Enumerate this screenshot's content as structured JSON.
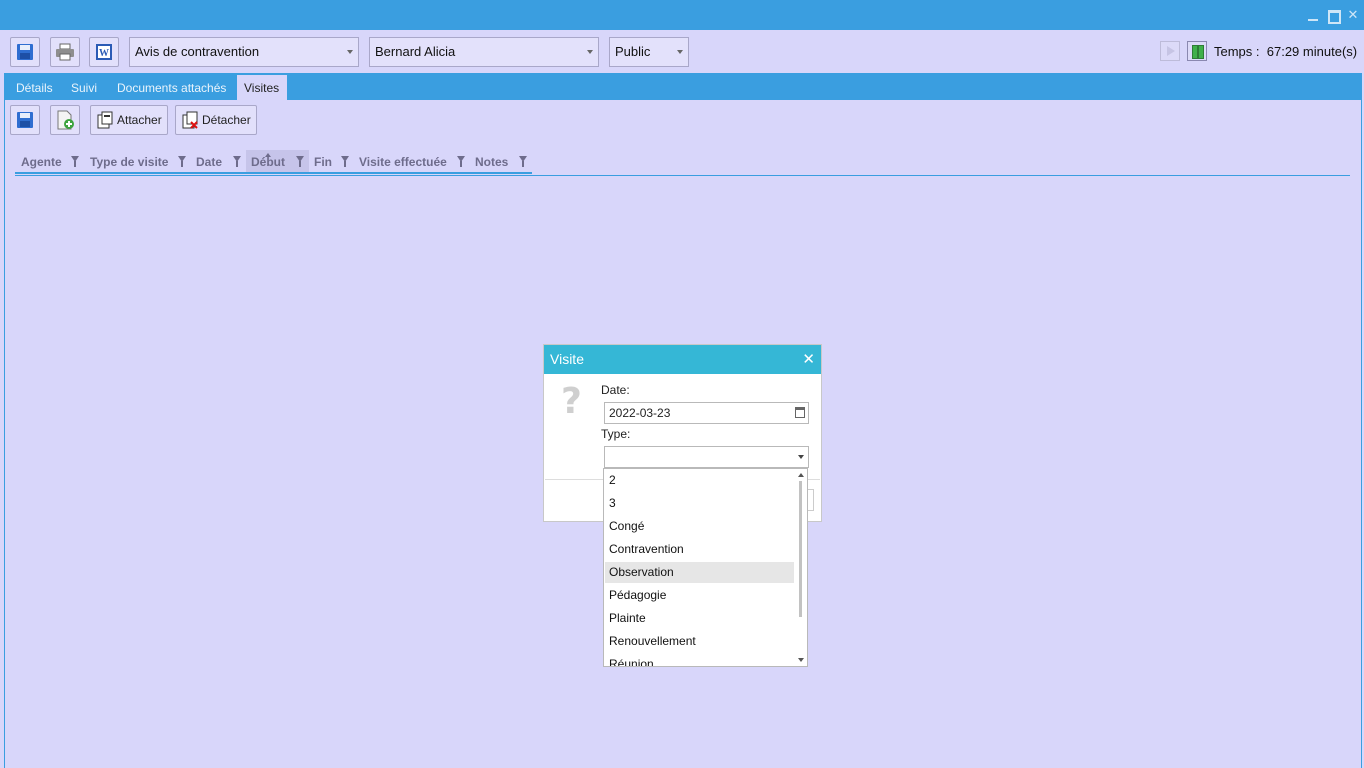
{
  "window": {
    "min_icon": "minimize-icon",
    "max_icon": "maximize-icon",
    "close_label": "✕"
  },
  "toolbar": {
    "document_type": "Avis de contravention",
    "person": "Bernard Alicia",
    "visibility": "Public",
    "timer_label": "Temps :",
    "timer_value": "67:29",
    "timer_unit": "minute(s)"
  },
  "tabs": [
    {
      "label": "Détails"
    },
    {
      "label": "Suivi"
    },
    {
      "label": "Documents attachés"
    },
    {
      "label": "Visites"
    }
  ],
  "subtoolbar": {
    "attach_label": "Attacher",
    "detach_label": "Détacher"
  },
  "grid": {
    "columns": [
      "Agente",
      "Type de visite",
      "Date",
      "Début",
      "Fin",
      "Visite effectuée",
      "Notes"
    ]
  },
  "dialog": {
    "title": "Visite",
    "close_label": "✕",
    "question_mark": "?",
    "date_label": "Date:",
    "date_value": "2022-03-23",
    "type_label": "Type:",
    "type_value": ""
  },
  "dropdown": {
    "options": [
      "2",
      "3",
      "Congé",
      "Contravention",
      "Observation",
      "Pédagogie",
      "Plainte",
      "Renouvellement",
      "Réunion"
    ],
    "highlighted": "Observation"
  },
  "colors": {
    "accent": "#3a9ee0",
    "background": "#d8d6fa",
    "dialog_title": "#35b7d6"
  }
}
